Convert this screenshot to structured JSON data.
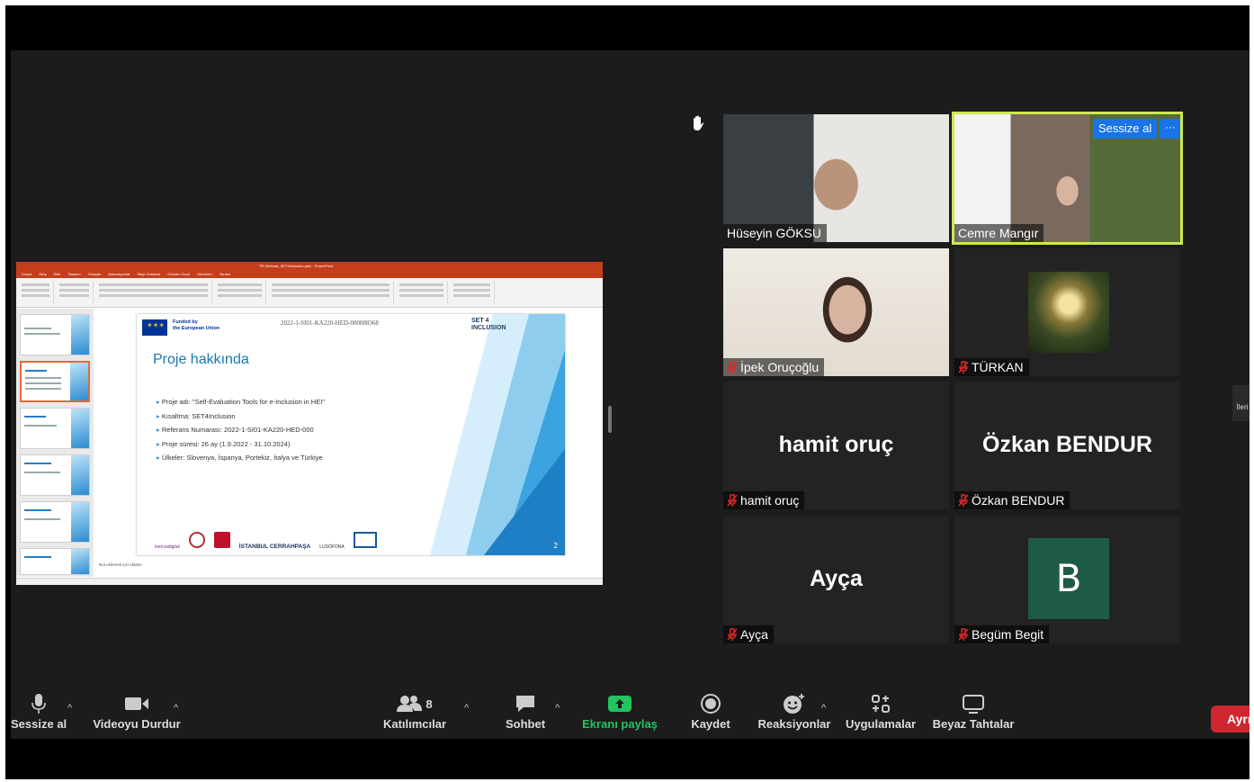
{
  "share": {
    "window_title": "TR-Webinar_SET4Inclusion.pptx - PowerPoint",
    "ribbon_tabs": [
      "Dosya",
      "Giriş",
      "Ekle",
      "Tasarım",
      "Geçişler",
      "Animasyonlar",
      "Slayt Gösterisi",
      "Gözden Geçir",
      "Görünüm",
      "Yardım"
    ],
    "slide": {
      "funded_line1": "Funded by",
      "funded_line2": "the European Union",
      "ref_top": "2022-1-SI01-KA220-HED-000088368",
      "brand_line1": "SET 4",
      "brand_line2": "INCLUSION",
      "title": "Proje hakkında",
      "bullets": [
        "Proje adı: \"Self-Evaluation Tools for e-Inclusion in HEI\"",
        "Kısaltma: SET4Inclusion",
        "Referans Numarası: 2022-1-SI01-KA220-HED-000",
        "Proje süresi: 26 ay (1.9.2022 - 31.10.2024)",
        "Ülkeler: Slovenya, İspanya, Portekiz, İtalya ve Türkiye"
      ],
      "logo_inercia": "inerciadigital",
      "logo_istanbul": "İSTANBUL CERRAHPAŞA",
      "logo_lusofona": "LUSÓFONA",
      "number": "2"
    },
    "notes_text": "Not eklemek için tıklatın"
  },
  "participants": [
    {
      "name": "Hüseyin GÖKSU",
      "muted": false,
      "video": true
    },
    {
      "name": "Cemre Mangır",
      "muted": false,
      "video": true,
      "active": true
    },
    {
      "name": "İpek Oruçoğlu",
      "muted": true,
      "video": true
    },
    {
      "name": "TÜRKAN",
      "muted": true,
      "video": false
    },
    {
      "name": "hamit oruç",
      "muted": true,
      "video": false,
      "display": "hamit oruç"
    },
    {
      "name": "Özkan BENDUR",
      "muted": true,
      "video": false,
      "display": "Özkan BENDUR"
    },
    {
      "name": "Ayça",
      "muted": true,
      "video": false,
      "display": "Ayça"
    },
    {
      "name": "Begüm Begit",
      "muted": true,
      "video": false,
      "avatar_letter": "B"
    }
  ],
  "active_tile": {
    "mute_button": "Sessize al",
    "more_button": "···"
  },
  "next_page": "İleri",
  "toolbar": {
    "mute": "Sessize al",
    "video": "Videoyu Durdur",
    "participants": "Katılımcılar",
    "participants_count": "8",
    "chat": "Sohbet",
    "share": "Ekranı paylaş",
    "record": "Kaydet",
    "reactions": "Reaksiyonlar",
    "apps": "Uygulamalar",
    "whiteboards": "Beyaz Tahtalar",
    "leave": "Ayrıl"
  },
  "colors": {
    "share_green": "#22c55e",
    "active_outline": "#cde84f",
    "leave_red": "#d0262f",
    "avatar_bg": "#1e5b46",
    "powerpoint": "#c43e1c"
  }
}
